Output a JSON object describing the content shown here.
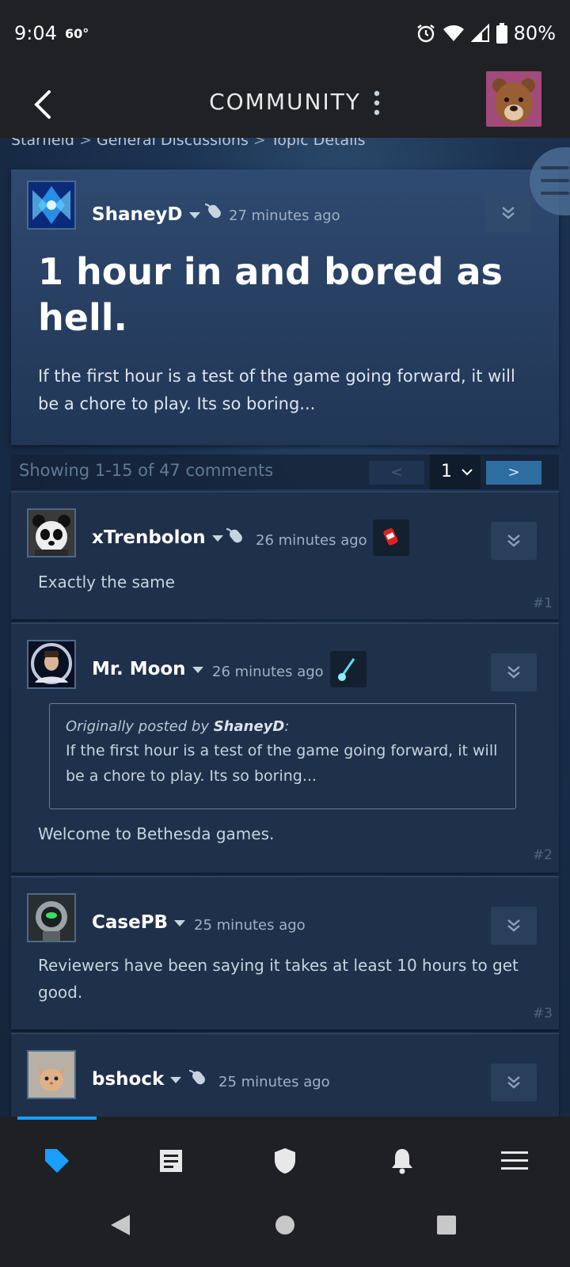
{
  "status_bar": {
    "time": "9:04",
    "temperature": "60°",
    "battery": "80%",
    "icons": [
      "alarm-icon",
      "wifi-icon",
      "signal-icon",
      "battery-icon"
    ]
  },
  "header": {
    "title": "COMMUNITY",
    "icons": [
      "back-arrow-icon",
      "more-vert-icon",
      "user-avatar-bear"
    ]
  },
  "breadcrumb": {
    "items": [
      "Starfield",
      "General Discussions",
      "Topic Details"
    ],
    "separator": ">"
  },
  "topic": {
    "author": "ShaneyD",
    "time": "27 minutes ago",
    "title": "1 hour in and bored as hell.",
    "body": "If the first hour is a test of the game going forward, it will be a chore to play. Its so boring..."
  },
  "pagination": {
    "summary": "Showing 1-15 of 47 comments",
    "prev": "<",
    "page": "1",
    "next": ">"
  },
  "comments": [
    {
      "author": "xTrenbolon",
      "time": "26 minutes ago",
      "text": "Exactly the same",
      "number": "#1"
    },
    {
      "author": "Mr. Moon",
      "time": "26 minutes ago",
      "quote_prefix": "Originally posted by ",
      "quote_author": "ShaneyD",
      "quote_suffix": ":",
      "quote_text": "If the first hour is a test of the game going forward, it will be a chore to play. Its so boring...",
      "text": "Welcome to Bethesda games.",
      "number": "#2"
    },
    {
      "author": "CasePB",
      "time": "25 minutes ago",
      "text": "Reviewers have been saying it takes at least 10 hours to get good.",
      "number": "#3"
    },
    {
      "author": "bshock",
      "time": "25 minutes ago"
    }
  ],
  "bottom_nav": [
    "store-tag-icon",
    "news-icon",
    "shield-guard-icon",
    "notifications-bell-icon",
    "hamburger-menu-icon"
  ],
  "colors": {
    "accent": "#1a9fff",
    "background": "#1b2838",
    "card": "#1f304a",
    "next_button": "#2e6da0"
  }
}
